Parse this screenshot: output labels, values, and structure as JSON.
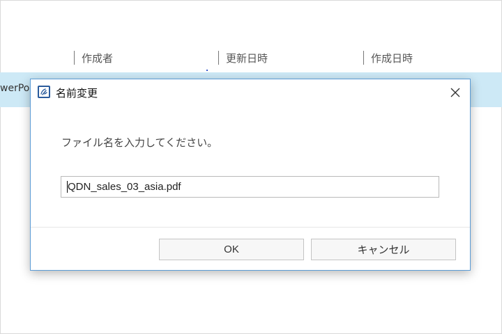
{
  "file_list": {
    "columns": {
      "author": "作成者",
      "updated": "更新日時",
      "created": "作成日時"
    },
    "selected_row_name": "werPoi"
  },
  "dialog": {
    "title": "名前変更",
    "prompt": "ファイル名を入力してください。",
    "filename_value": "QDN_sales_03_asia.pdf",
    "ok_label": "OK",
    "cancel_label": "キャンセル",
    "icons": {
      "app": "rename-app-icon",
      "close": "close-icon"
    }
  },
  "colors": {
    "selected_row": "#cde9f6",
    "dialog_border": "#5b9bd5",
    "icon_blue": "#2a5b9c"
  }
}
